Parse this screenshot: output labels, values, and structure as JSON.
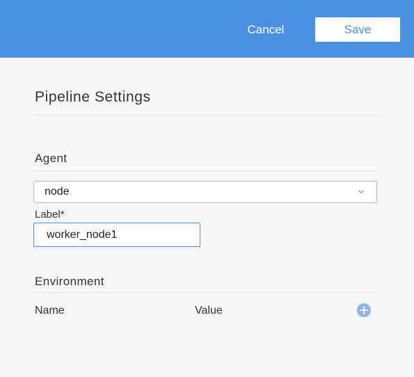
{
  "header": {
    "cancel_label": "Cancel",
    "save_label": "Save"
  },
  "panel": {
    "title": "Pipeline Settings"
  },
  "agent": {
    "section_label": "Agent",
    "selected_value": "node",
    "label_field": {
      "label": "Label*",
      "value": "worker_node1"
    }
  },
  "environment": {
    "section_label": "Environment",
    "columns": [
      "Name",
      "Value"
    ]
  },
  "icons": {
    "dropdown": "chevron-down-icon",
    "add": "plus-circle-icon"
  },
  "colors": {
    "accent": "#4a90e2",
    "background": "#f6f6f6",
    "add_icon": "#8fb5e6"
  }
}
